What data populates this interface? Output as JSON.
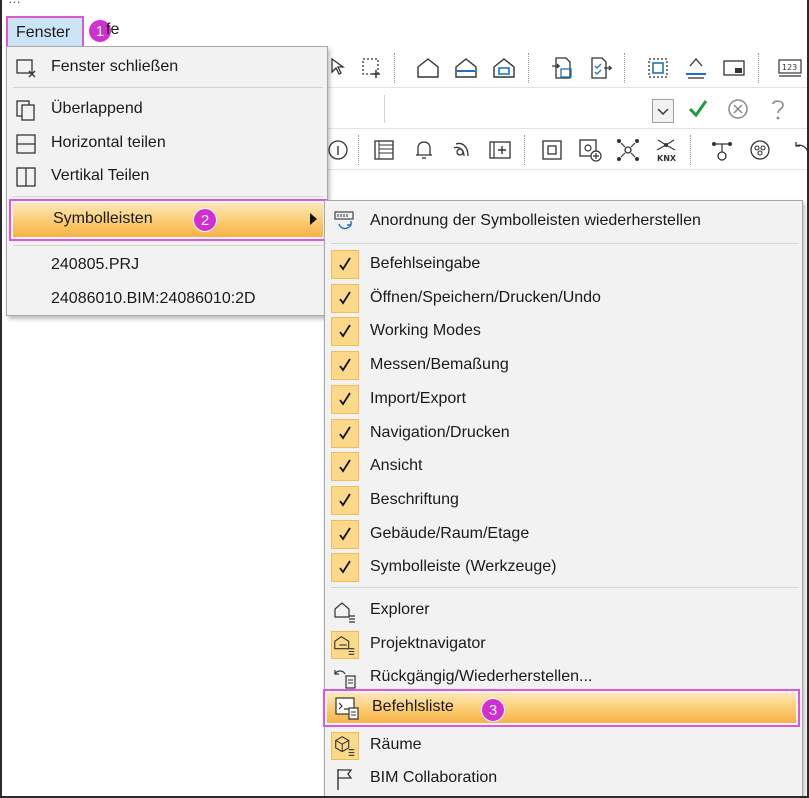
{
  "menubar": {
    "fenster_label": "Fenster",
    "hilfe_label": "fe",
    "step1": "1"
  },
  "fenster_menu": {
    "items": [
      {
        "label": "Fenster schließen",
        "icon": "window-close-icon"
      },
      {
        "label": "Überlappend",
        "icon": "cascade-windows-icon"
      },
      {
        "label": "Horizontal teilen",
        "icon": "split-horizontal-icon"
      },
      {
        "label": "Vertikal Teilen",
        "icon": "split-vertical-icon"
      },
      {
        "label": "Symbolleisten",
        "icon": "submenu-arrow-icon"
      },
      {
        "label": "240805.PRJ"
      },
      {
        "label": "24086010.BIM:24086010:2D"
      }
    ],
    "step2": "2"
  },
  "symbolleisten_menu": {
    "restore_label": "Anordnung der Symbolleisten wiederherstellen",
    "checked_items": [
      "Befehlseingabe",
      "Öffnen/Speichern/Drucken/Undo",
      "Working Modes",
      "Messen/Bemaßung",
      "Import/Export",
      "Navigation/Drucken",
      "Ansicht",
      "Beschriftung",
      "Gebäude/Raum/Etage",
      "Symbolleiste (Werkzeuge)"
    ],
    "panel_items": [
      {
        "label": "Explorer",
        "icon": "explorer-icon"
      },
      {
        "label": "Projektnavigator",
        "icon": "project-navigator-icon"
      },
      {
        "label": "Rückgängig/Wiederherstellen...",
        "icon": "undo-redo-list-icon"
      },
      {
        "label": "Befehlsliste",
        "icon": "command-list-icon"
      },
      {
        "label": "Räume",
        "icon": "rooms-icon"
      },
      {
        "label": "BIM Collaboration",
        "icon": "bim-flag-icon"
      }
    ],
    "step3": "3"
  },
  "colors": {
    "highlight_border": "#d85ad8",
    "badge": "#d12fd1",
    "menu_hover_top": "#fde8b8",
    "menu_hover_bottom": "#f6b14a",
    "check_box": "#fcd98a",
    "ok_green": "#1f9d3a"
  }
}
